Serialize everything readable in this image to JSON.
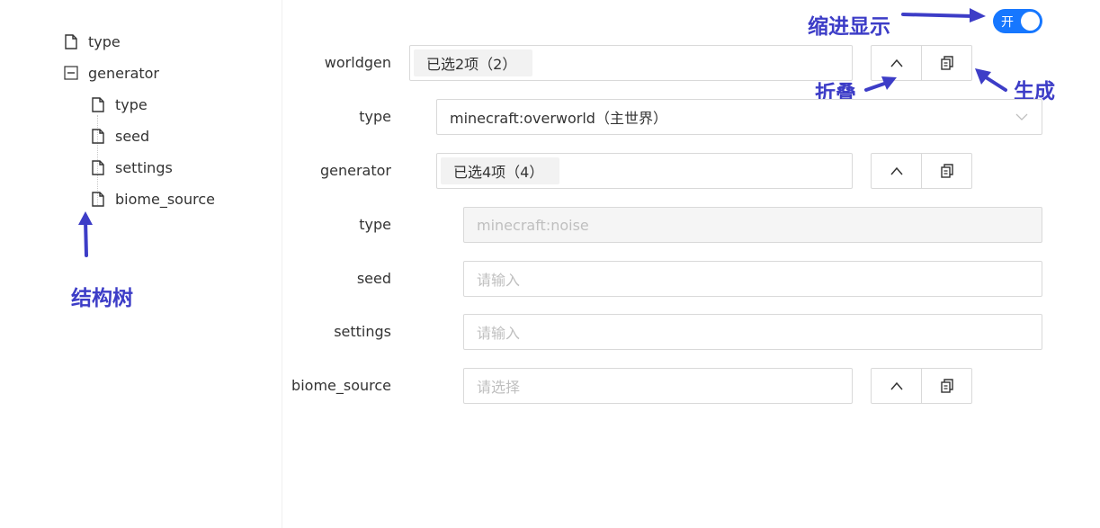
{
  "tree": {
    "items": [
      {
        "label": "type",
        "icon": "file-icon"
      },
      {
        "label": "generator",
        "icon": "collapse-square-icon"
      },
      {
        "label": "type",
        "icon": "file-icon"
      },
      {
        "label": "seed",
        "icon": "file-icon"
      },
      {
        "label": "settings",
        "icon": "file-icon"
      },
      {
        "label": "biome_source",
        "icon": "file-icon"
      }
    ]
  },
  "form": {
    "worldgen": {
      "label": "worldgen",
      "tag": "已选2项（2）"
    },
    "type1": {
      "label": "type",
      "value": "minecraft:overworld（主世界）"
    },
    "generator": {
      "label": "generator",
      "tag": "已选4项（4）"
    },
    "type2": {
      "label": "type",
      "value": "minecraft:noise"
    },
    "seed": {
      "label": "seed",
      "placeholder": "请输入"
    },
    "settings": {
      "label": "settings",
      "placeholder": "请输入"
    },
    "biome_source": {
      "label": "biome_source",
      "placeholder": "请选择"
    }
  },
  "switch": {
    "label": "开",
    "checked": true,
    "color": "#1677ff"
  },
  "annotations": {
    "indent": "缩进显示",
    "fold": "折叠",
    "generate": "生成",
    "tree": "结构树",
    "color": "#3d3dc7"
  }
}
